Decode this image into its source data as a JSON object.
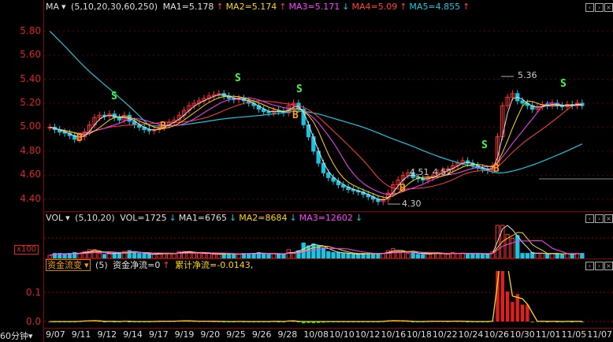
{
  "main_panel": {
    "indicator": "MA",
    "params": "(5,10,20,30,60,250)",
    "ma_values": [
      {
        "label": "MA1=5.178",
        "arrow": "↑",
        "dir": "up",
        "color": "#e0e0e0"
      },
      {
        "label": "MA2=5.174",
        "arrow": "↑",
        "dir": "up",
        "color": "#ffd700"
      },
      {
        "label": "MA3=5.171",
        "arrow": "↓",
        "dir": "down",
        "color": "#ff40ff"
      },
      {
        "label": "MA4=5.09",
        "arrow": "↑",
        "dir": "up",
        "color": "#ff4040"
      },
      {
        "label": "MA5=4.855",
        "arrow": "↑",
        "dir": "up",
        "color": "#19c5e0"
      }
    ],
    "y_ticks": [
      "5.80",
      "5.60",
      "5.40",
      "5.20",
      "5.00",
      "4.80",
      "4.60",
      "4.40"
    ],
    "annotations": {
      "high": "5.36",
      "low": "4.30",
      "mid1": "4.51",
      "mid2": "4.52"
    },
    "signals": {
      "sell": "S",
      "buy": "B"
    }
  },
  "vol_panel": {
    "indicator": "VOL",
    "params": "(5,10,20)",
    "values": [
      {
        "label": "VOL=1725",
        "arrow": "↓",
        "dir": "down",
        "color": "#e0e0e0"
      },
      {
        "label": "MA1=6765",
        "arrow": "↓",
        "dir": "down",
        "color": "#e0e0e0"
      },
      {
        "label": "MA2=8684",
        "arrow": "↓",
        "dir": "down",
        "color": "#ffd700"
      },
      {
        "label": "MA3=12602",
        "arrow": "↓",
        "dir": "down",
        "color": "#ff40ff"
      }
    ],
    "scale_label": "x100"
  },
  "flow_panel": {
    "indicator": "资金流变",
    "params": "(5)",
    "net_flow": "资金净流=0",
    "net_arrow": "↑",
    "cum_flow": "累计净流=-0.0143,",
    "y_ticks": [
      "0.1",
      "0.0"
    ]
  },
  "x_axis": {
    "period": "60分钟",
    "dates": [
      "9/07",
      "9/11",
      "9/12",
      "9/14",
      "9/17",
      "9/19",
      "9/20",
      "9/25",
      "9/26",
      "9/28",
      "10/08",
      "10/10",
      "10/12",
      "10/16",
      "10/18",
      "10/22",
      "10/24",
      "10/26",
      "10/30",
      "11/01",
      "11/05",
      "11/07"
    ]
  },
  "colors": {
    "up": "#ff3030",
    "down": "#19c5e0",
    "axis": "#8b0000"
  },
  "chart_data": {
    "type": "candlestick",
    "ylim": [
      4.3,
      5.85
    ],
    "close_series": [
      5.0,
      4.98,
      4.96,
      4.95,
      4.93,
      4.9,
      4.92,
      4.96,
      5.02,
      5.08,
      5.1,
      5.09,
      5.11,
      5.08,
      5.06,
      5.1,
      5.05,
      5.02,
      5.0,
      4.98,
      4.97,
      4.98,
      5.0,
      5.02,
      5.04,
      5.06,
      5.1,
      5.14,
      5.18,
      5.2,
      5.22,
      5.24,
      5.26,
      5.27,
      5.28,
      5.26,
      5.24,
      5.23,
      5.24,
      5.22,
      5.2,
      5.18,
      5.15,
      5.13,
      5.12,
      5.14,
      5.13,
      5.12,
      5.18,
      5.2,
      5.15,
      5.02,
      4.92,
      4.8,
      4.7,
      4.62,
      4.58,
      4.55,
      4.52,
      4.5,
      4.48,
      4.47,
      4.46,
      4.44,
      4.42,
      4.4,
      4.38,
      4.4,
      4.45,
      4.52,
      4.56,
      4.6,
      4.62,
      4.58,
      4.57,
      4.56,
      4.58,
      4.6,
      4.62,
      4.64,
      4.65,
      4.68,
      4.7,
      4.72,
      4.7,
      4.68,
      4.66,
      4.65,
      4.64,
      4.68,
      4.92,
      5.18,
      5.25,
      5.28,
      5.22,
      5.2,
      5.18,
      5.15,
      5.17,
      5.19,
      5.18,
      5.2,
      5.18,
      5.17,
      5.19,
      5.18,
      5.2,
      5.18
    ]
  }
}
